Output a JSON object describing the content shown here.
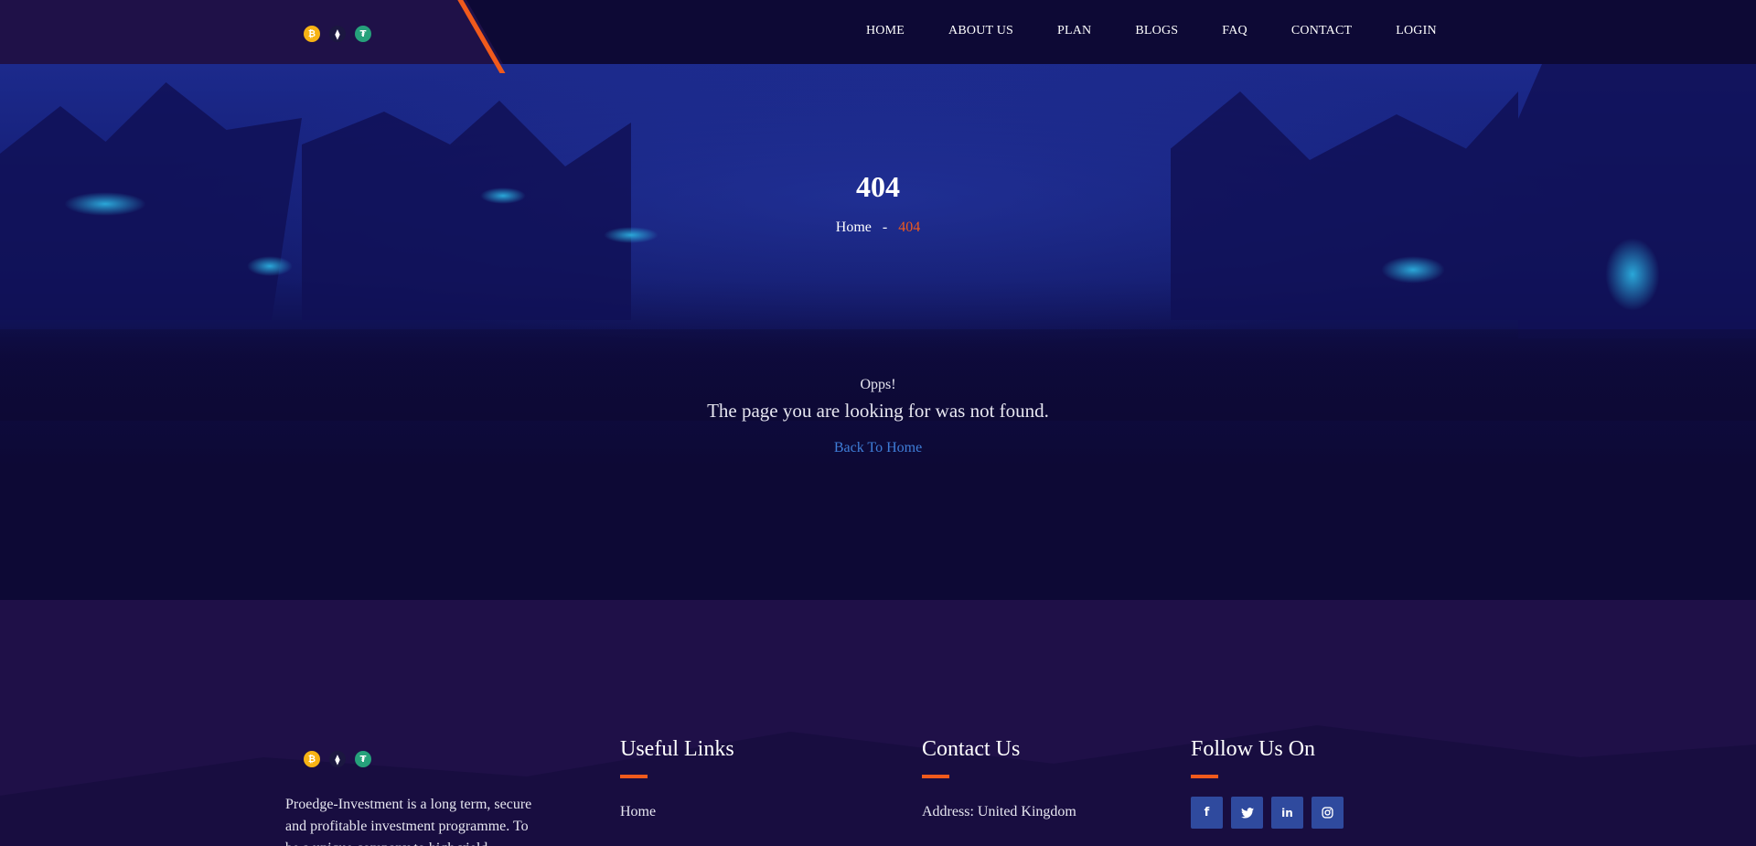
{
  "header": {
    "coins": [
      {
        "symbol": "₿",
        "name": "bitcoin-icon"
      },
      {
        "symbol": "⧫",
        "name": "ethereum-icon"
      },
      {
        "symbol": "₮",
        "name": "tether-icon"
      }
    ],
    "nav": [
      {
        "label": "HOME"
      },
      {
        "label": "ABOUT US"
      },
      {
        "label": "PLAN"
      },
      {
        "label": "BLOGS"
      },
      {
        "label": "FAQ"
      },
      {
        "label": "CONTACT"
      },
      {
        "label": "LOGIN"
      }
    ]
  },
  "hero": {
    "title": "404",
    "breadcrumb": {
      "home": "Home",
      "separator": "-",
      "current": "404"
    }
  },
  "error": {
    "small": "Opps!",
    "large": "The page you are looking for was not found.",
    "back_link": "Back To Home"
  },
  "footer": {
    "about": "Proedge-Investment is a long term, secure and profitable investment programme. To be a unique company to high yield...",
    "useful_links": {
      "title": "Useful Links",
      "items": [
        "Home"
      ]
    },
    "contact": {
      "title": "Contact Us",
      "address": "Address: United Kingdom"
    },
    "follow": {
      "title": "Follow Us On",
      "socials": [
        "f",
        "t",
        "in",
        "ig"
      ]
    }
  },
  "colors": {
    "accent": "#f05a1c",
    "link": "#3f7ed8",
    "background": "#0d0935",
    "footer_bg": "#1f1048",
    "social_bg": "#2f4a9e"
  }
}
